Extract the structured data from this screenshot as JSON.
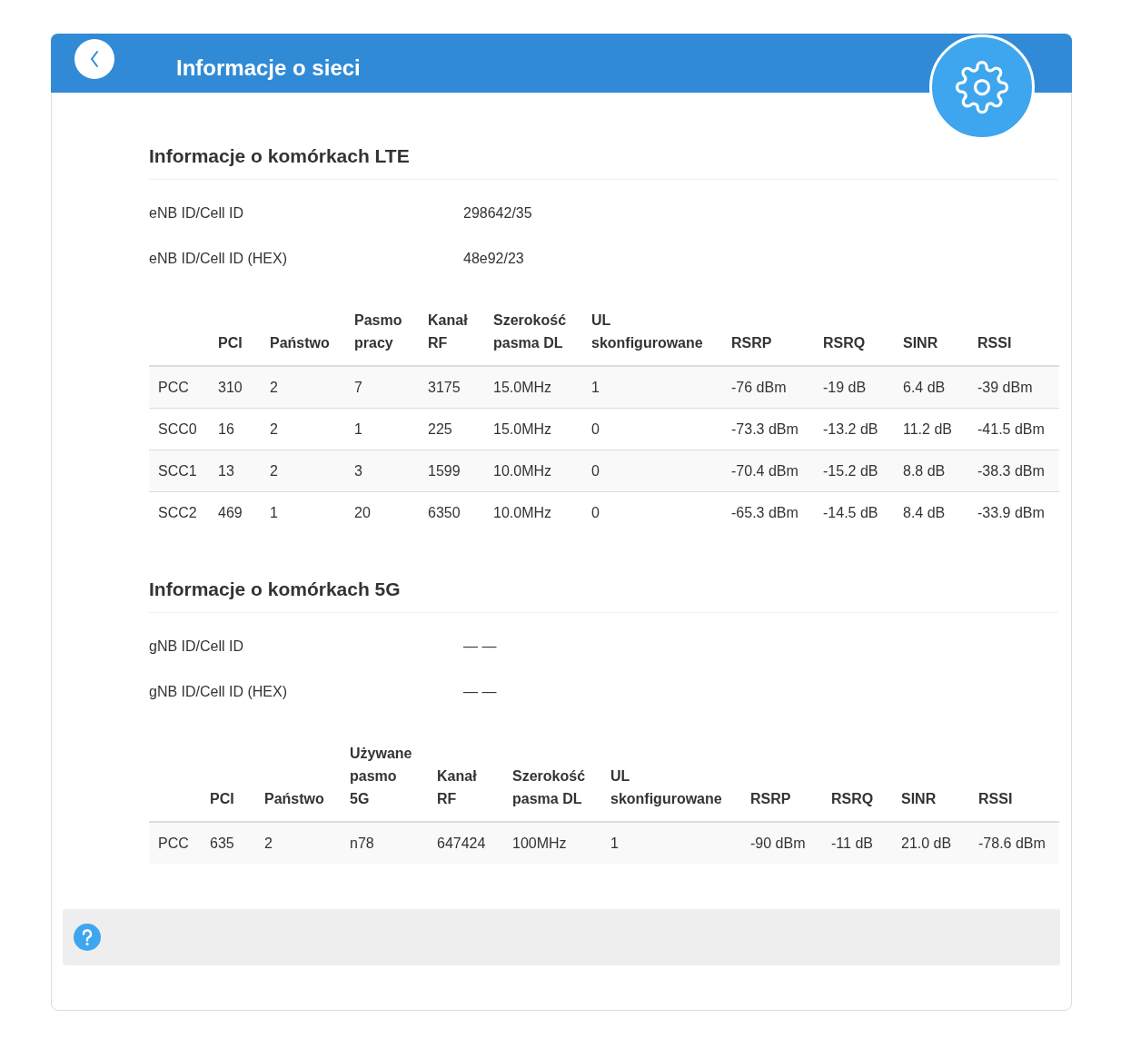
{
  "header": {
    "title": "Informacje o sieci"
  },
  "sections": [
    {
      "title": "Informacje o komórkach LTE",
      "info": [
        {
          "label": "eNB ID/Cell ID",
          "value": "298642/35"
        },
        {
          "label": "eNB ID/Cell ID (HEX)",
          "value": "48e92/23"
        }
      ],
      "table": {
        "columns": [
          "",
          "PCI",
          "Państwo",
          "Pasmo pracy",
          "Kanał RF",
          "Szerokość pasma DL",
          "UL skonfigurowane",
          "RSRP",
          "RSRQ",
          "SINR",
          "RSSI"
        ],
        "rows": [
          [
            "PCC",
            "310",
            "2",
            "7",
            "3175",
            "15.0MHz",
            "1",
            "-76 dBm",
            "-19 dB",
            "6.4 dB",
            "-39 dBm"
          ],
          [
            "SCC0",
            "16",
            "2",
            "1",
            "225",
            "15.0MHz",
            "0",
            "-73.3 dBm",
            "-13.2 dB",
            "11.2 dB",
            "-41.5 dBm"
          ],
          [
            "SCC1",
            "13",
            "2",
            "3",
            "1599",
            "10.0MHz",
            "0",
            "-70.4 dBm",
            "-15.2 dB",
            "8.8 dB",
            "-38.3 dBm"
          ],
          [
            "SCC2",
            "469",
            "1",
            "20",
            "6350",
            "10.0MHz",
            "0",
            "-65.3 dBm",
            "-14.5 dB",
            "8.4 dB",
            "-33.9 dBm"
          ]
        ]
      }
    },
    {
      "title": "Informacje o komórkach 5G",
      "info": [
        {
          "label": "gNB ID/Cell ID",
          "value": "— —"
        },
        {
          "label": "gNB ID/Cell ID (HEX)",
          "value": "— —"
        }
      ],
      "table": {
        "columns": [
          "",
          "PCI",
          "Państwo",
          "Używane pasmo 5G",
          "Kanał RF",
          "Szerokość pasma DL",
          "UL skonfigurowane",
          "RSRP",
          "RSRQ",
          "SINR",
          "RSSI"
        ],
        "rows": [
          [
            "PCC",
            "635",
            "2",
            "n78",
            "647424",
            "100MHz",
            "1",
            "-90 dBm",
            "-11 dB",
            "21.0 dB",
            "-78.6 dBm"
          ]
        ]
      }
    }
  ]
}
